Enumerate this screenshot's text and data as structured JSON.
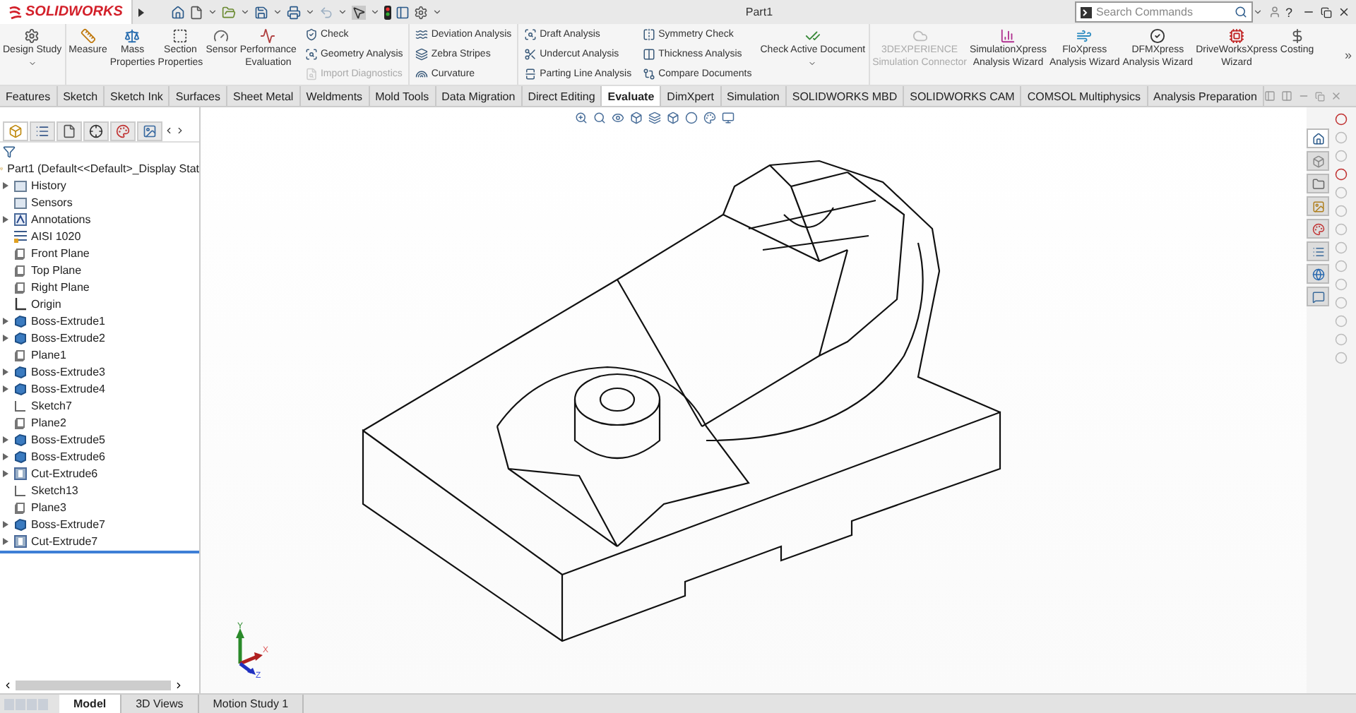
{
  "window": {
    "logo": "SOLIDWORKS",
    "title": "Part1",
    "help": "?"
  },
  "search": {
    "placeholder": "Search Commands"
  },
  "ribbon": {
    "groups": [
      {
        "kind": "large",
        "items": [
          {
            "label": "Design Study",
            "caret": true,
            "disabled": false
          }
        ]
      },
      {
        "kind": "large",
        "items": [
          {
            "label": "Measure",
            "caret": false,
            "disabled": false
          },
          {
            "label": "Mass\nProperties",
            "caret": false,
            "disabled": false
          },
          {
            "label": "Section\nProperties",
            "caret": false,
            "disabled": false
          },
          {
            "label": "Sensor",
            "caret": false,
            "disabled": false
          },
          {
            "label": "Performance\nEvaluation",
            "caret": false,
            "disabled": false
          }
        ]
      },
      {
        "kind": "column",
        "items": [
          {
            "label": "Check",
            "disabled": false
          },
          {
            "label": "Geometry Analysis",
            "disabled": false
          },
          {
            "label": "Import Diagnostics",
            "disabled": true
          }
        ]
      },
      {
        "kind": "column",
        "items": [
          {
            "label": "Deviation Analysis",
            "disabled": false
          },
          {
            "label": "Zebra Stripes",
            "disabled": false
          },
          {
            "label": "Curvature",
            "disabled": false
          }
        ]
      },
      {
        "kind": "column",
        "items": [
          {
            "label": "Draft Analysis",
            "disabled": false
          },
          {
            "label": "Undercut Analysis",
            "disabled": false
          },
          {
            "label": "Parting Line Analysis",
            "disabled": false
          }
        ]
      },
      {
        "kind": "column",
        "items": [
          {
            "label": "Symmetry Check",
            "disabled": false
          },
          {
            "label": "Thickness Analysis",
            "disabled": false
          },
          {
            "label": "Compare Documents",
            "disabled": false
          }
        ]
      },
      {
        "kind": "large",
        "items": [
          {
            "label": "Check Active Document",
            "caret": true,
            "disabled": false
          }
        ]
      },
      {
        "kind": "large",
        "items": [
          {
            "label": "3DEXPERIENCE\nSimulation Connector",
            "caret": false,
            "disabled": true
          },
          {
            "label": "SimulationXpress\nAnalysis Wizard",
            "caret": false,
            "disabled": false
          },
          {
            "label": "FloXpress\nAnalysis Wizard",
            "caret": false,
            "disabled": false
          },
          {
            "label": "DFMXpress\nAnalysis Wizard",
            "caret": false,
            "disabled": false
          },
          {
            "label": "DriveWorksXpress\nWizard",
            "caret": false,
            "disabled": false
          },
          {
            "label": "Costing",
            "caret": false,
            "disabled": false
          }
        ]
      }
    ],
    "more": "»"
  },
  "tabs": [
    {
      "label": "Features",
      "selected": false
    },
    {
      "label": "Sketch",
      "selected": false
    },
    {
      "label": "Sketch Ink",
      "selected": false
    },
    {
      "label": "Surfaces",
      "selected": false
    },
    {
      "label": "Sheet Metal",
      "selected": false
    },
    {
      "label": "Weldments",
      "selected": false
    },
    {
      "label": "Mold Tools",
      "selected": false
    },
    {
      "label": "Data Migration",
      "selected": false
    },
    {
      "label": "Direct Editing",
      "selected": false
    },
    {
      "label": "Evaluate",
      "selected": true
    },
    {
      "label": "DimXpert",
      "selected": false
    },
    {
      "label": "Simulation",
      "selected": false
    },
    {
      "label": "SOLIDWORKS MBD",
      "selected": false
    },
    {
      "label": "SOLIDWORKS CAM",
      "selected": false
    },
    {
      "label": "COMSOL Multiphysics",
      "selected": false
    },
    {
      "label": "Analysis Preparation",
      "selected": false
    }
  ],
  "task_pane": {
    "tabs": [
      {
        "selected": true
      },
      {
        "selected": false
      },
      {
        "selected": false
      },
      {
        "selected": false
      },
      {
        "selected": false
      },
      {
        "selected": false
      },
      {
        "selected": false
      },
      {
        "selected": false
      }
    ]
  },
  "feature_manager": {
    "panel_tabs": [
      {
        "selected": true
      },
      {
        "selected": false
      },
      {
        "selected": false
      },
      {
        "selected": false
      },
      {
        "selected": false
      },
      {
        "selected": false
      }
    ],
    "root": "Part1  (Default<<Default>_Display Stat",
    "items": [
      {
        "label": "History",
        "kind": "folder",
        "collapsible": true
      },
      {
        "label": "Sensors",
        "kind": "folder",
        "collapsible": false
      },
      {
        "label": "Annotations",
        "kind": "annotation",
        "collapsible": true
      },
      {
        "label": "AISI 1020",
        "kind": "material",
        "collapsible": false
      },
      {
        "label": "Front Plane",
        "kind": "plane",
        "collapsible": false
      },
      {
        "label": "Top Plane",
        "kind": "plane",
        "collapsible": false
      },
      {
        "label": "Right Plane",
        "kind": "plane",
        "collapsible": false
      },
      {
        "label": "Origin",
        "kind": "origin",
        "collapsible": false
      },
      {
        "label": "Boss-Extrude1",
        "kind": "boss",
        "collapsible": true
      },
      {
        "label": "Boss-Extrude2",
        "kind": "boss",
        "collapsible": true
      },
      {
        "label": "Plane1",
        "kind": "plane",
        "collapsible": false
      },
      {
        "label": "Boss-Extrude3",
        "kind": "boss",
        "collapsible": true
      },
      {
        "label": "Boss-Extrude4",
        "kind": "boss",
        "collapsible": true
      },
      {
        "label": "Sketch7",
        "kind": "sketch",
        "collapsible": false
      },
      {
        "label": "Plane2",
        "kind": "plane",
        "collapsible": false
      },
      {
        "label": "Boss-Extrude5",
        "kind": "boss",
        "collapsible": true
      },
      {
        "label": "Boss-Extrude6",
        "kind": "boss",
        "collapsible": true
      },
      {
        "label": "Cut-Extrude6",
        "kind": "cut",
        "collapsible": true
      },
      {
        "label": "Sketch13",
        "kind": "sketch",
        "collapsible": false
      },
      {
        "label": "Plane3",
        "kind": "plane",
        "collapsible": false
      },
      {
        "label": "Boss-Extrude7",
        "kind": "boss",
        "collapsible": true
      },
      {
        "label": "Cut-Extrude7",
        "kind": "cut",
        "collapsible": true
      }
    ]
  },
  "triad": {
    "y": "Y",
    "x": "X",
    "z": "Z"
  },
  "bottom_tabs": [
    {
      "label": "Model",
      "selected": true
    },
    {
      "label": "3D Views",
      "selected": false
    },
    {
      "label": "Motion Study 1",
      "selected": false
    }
  ]
}
